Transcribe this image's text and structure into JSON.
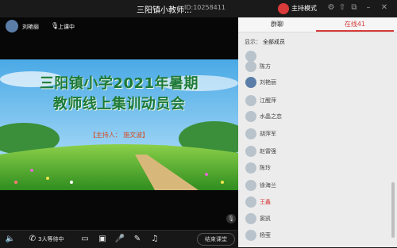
{
  "window": {
    "title": "三阳镇小教师...",
    "meeting_id": "ID:10258411",
    "mode_label": "主持模式",
    "icons": [
      "settings-icon",
      "share-icon",
      "popout-icon",
      "minimize-icon",
      "close-icon"
    ]
  },
  "stage": {
    "host_name": "刘艳丽",
    "lesson_status": "上课中",
    "slide": {
      "title_line1": "三阳镇小学2021年暑期",
      "title_line2": "教师线上集训动员会",
      "host_line": "【主持人： 施文波】"
    }
  },
  "toolbar": {
    "waiting_text": "3人等待中",
    "end_label": "结束课堂",
    "icons": [
      "speaker-icon",
      "phone-icon",
      "camera-icon",
      "image-icon",
      "mic-icon",
      "edit-icon",
      "music-icon"
    ]
  },
  "panel": {
    "tabs": [
      "群聊",
      "在线41"
    ],
    "filter_label": "显示：",
    "filter_value": "全部成员",
    "members": [
      "陈方",
      "刘艳丽",
      "江醒萍",
      "水晶之恋",
      "胡萍军",
      "赵雷强",
      "陈玲",
      "徐海兰",
      "王鑫",
      "窦凯",
      "杨莹"
    ]
  },
  "colors": {
    "accent": "#d53a3a",
    "slide_title": "#1d7a3a",
    "host_line": "#d64b20"
  }
}
